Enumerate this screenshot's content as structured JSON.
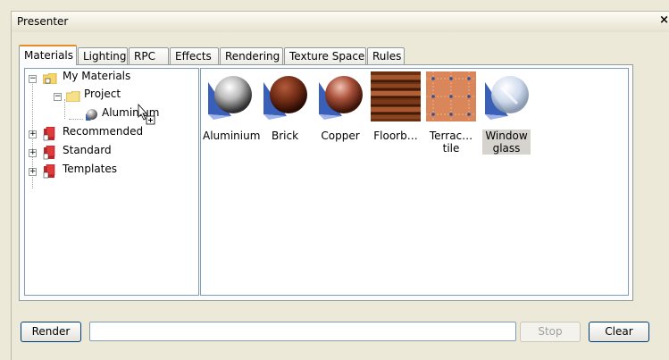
{
  "window": {
    "title": "Presenter",
    "close_glyph": "×"
  },
  "tabs": [
    {
      "label": "Materials",
      "active": true
    },
    {
      "label": "Lighting"
    },
    {
      "label": "RPC"
    },
    {
      "label": "Effects"
    },
    {
      "label": "Rendering"
    },
    {
      "label": "Texture Space"
    },
    {
      "label": "Rules"
    }
  ],
  "tree": [
    {
      "label": "My Materials",
      "icon": "folder-icon",
      "expanded": true
    },
    {
      "label": "Project",
      "icon": "folder-icon",
      "expanded": true
    },
    {
      "label": "Aluminium",
      "icon": "sphere-icon"
    },
    {
      "label": "Recommended",
      "icon": "book-icon",
      "expanded": false
    },
    {
      "label": "Standard",
      "icon": "book-icon",
      "expanded": false
    },
    {
      "label": "Templates",
      "icon": "book-icon",
      "expanded": false
    }
  ],
  "materials": [
    {
      "label": "Aluminium",
      "icon": "aluminium-sphere-icon"
    },
    {
      "label": "Brick",
      "icon": "brick-sphere-icon"
    },
    {
      "label": "Copper",
      "icon": "copper-sphere-icon"
    },
    {
      "label": "Floorb…",
      "icon": "floorboard-texture-icon"
    },
    {
      "label": "Terrac…\ntile",
      "icon": "terracotta-tile-texture-icon"
    },
    {
      "label": "Window\nglass",
      "icon": "glass-sphere-icon",
      "selected": true
    }
  ],
  "buttons": {
    "render": "Render",
    "stop": "Stop",
    "clear": "Clear"
  },
  "progress": {
    "value": ""
  },
  "colors": {
    "tab_accent": "#e68b2c",
    "selection": "#d6d3ce",
    "border": "#7f9db9"
  }
}
